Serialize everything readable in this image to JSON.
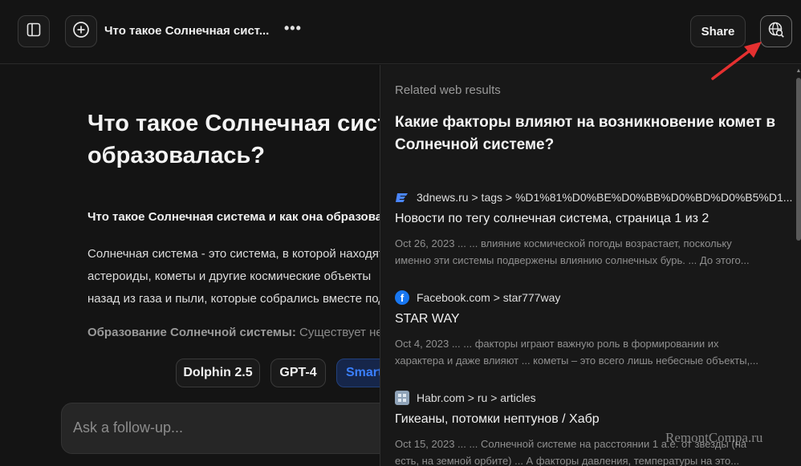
{
  "header": {
    "conversation_title": "Что такое Солнечная сист...",
    "more_label": "•••",
    "share_label": "Share"
  },
  "main": {
    "title_lines": [
      "Что такое Солнечная система и как она",
      "образовалась?"
    ],
    "subheading": "Что такое Солнечная система и как она образовалась?",
    "body_lines": [
      "Солнечная система - это система, в которой находятся",
      "астероиды, кометы и другие космические объекты",
      "назад из газа и пыли, которые собрались вместе под"
    ],
    "formation_label": "Образование Солнечной системы:",
    "formation_text": "Существует несколько",
    "models": [
      "Dolphin 2.5",
      "GPT-4",
      "Smart"
    ],
    "followup_placeholder": "Ask a follow-up..."
  },
  "related": {
    "heading": "Related web results",
    "question": "Какие факторы влияют на возникновение комет в Солнечной системе?",
    "results": [
      {
        "favicon": "3dnews-icon",
        "source": "3dnews.ru > tags > %D1%81%D0%BE%D0%BB%D0%BD%D0%B5%D1...",
        "title": "Новости по тегу солнечная система, страница 1 из 2",
        "snippet_lines": [
          "Oct 26, 2023 ... ... влияние космической погоды возрастает, поскольку",
          "именно эти системы подвержены влиянию солнечных бурь. ... До этого..."
        ]
      },
      {
        "favicon": "facebook-icon",
        "source": "Facebook.com > star777way",
        "title": "STAR WAY",
        "snippet_lines": [
          "Oct 4, 2023 ... ... факторы играют важную роль в формировании их",
          "характера и даже влияют ... кометы – это всего лишь небесные объекты,..."
        ]
      },
      {
        "favicon": "habr-icon",
        "source": "Habr.com > ru > articles",
        "title": "Гикеаны, потомки нептунов / Хабр",
        "snippet_lines": [
          "Oct 15, 2023 ... ... Солнечной системе на расстоянии 1 а.е. от звезды (на",
          "есть, на земной орбите) ... А факторы давления, температуры на это..."
        ]
      }
    ]
  },
  "watermark": "RemontCompa.ru",
  "colors": {
    "accent": "#3a7fff",
    "arrow": "#e53030",
    "background": "#141414"
  }
}
